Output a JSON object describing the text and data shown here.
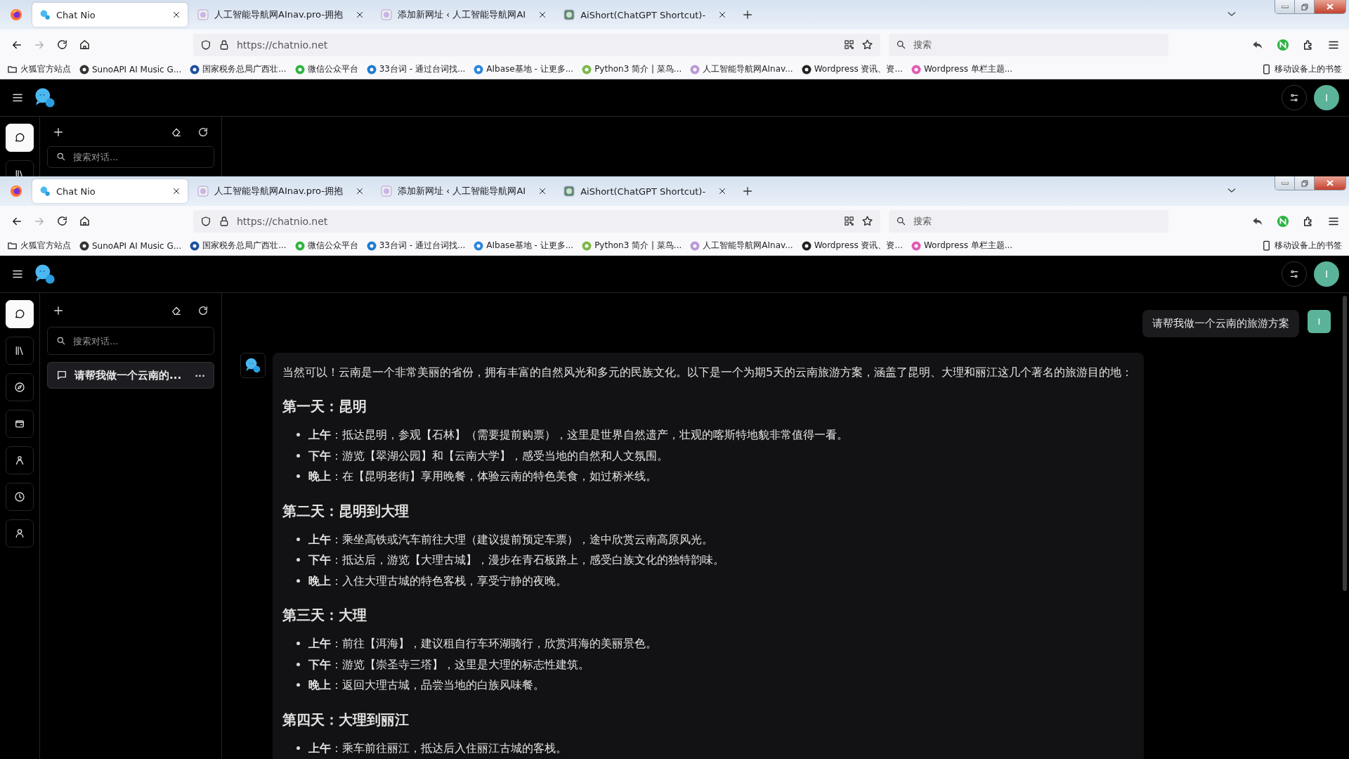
{
  "windows": [
    {
      "tabs": [
        {
          "title": "Chat Nio",
          "selected": true
        },
        {
          "title": "人工智能导航网AInav.pro-拥抱",
          "selected": false
        },
        {
          "title": "添加新网址 ‹ 人工智能导航网AI",
          "selected": false
        },
        {
          "title": "AiShort(ChatGPT Shortcut)-",
          "selected": false
        }
      ],
      "toolbar": {
        "back_disabled": false,
        "forward_disabled": true,
        "url": "https://chatnio.net",
        "search_placeholder": "搜索"
      },
      "bookmarks": [
        "火狐官方站点",
        "SunoAPI AI Music G...",
        "国家税务总局广西壮...",
        "微信公众平台",
        "33台词 - 通过台词找...",
        "AIbase基地 - 让更多...",
        "Python3 简介 | 菜鸟...",
        "人工智能导航网AInav...",
        "Wordpress 资讯、资...",
        "Wordpress 单栏主题..."
      ],
      "mobile_bookmarks": "移动设备上的书签",
      "app": {
        "user_initial": "I",
        "nav": [
          {
            "kind": "chat",
            "selected": true
          },
          {
            "kind": "library",
            "selected": false
          }
        ],
        "search_placeholder": "搜索对话..."
      }
    },
    {
      "tabs": [
        {
          "title": "Chat Nio",
          "selected": true
        },
        {
          "title": "人工智能导航网AInav.pro-拥抱",
          "selected": false
        },
        {
          "title": "添加新网址 ‹ 人工智能导航网AI",
          "selected": false
        },
        {
          "title": "AiShort(ChatGPT Shortcut)-",
          "selected": false
        }
      ],
      "toolbar": {
        "back_disabled": false,
        "forward_disabled": true,
        "url": "https://chatnio.net",
        "search_placeholder": "搜索"
      },
      "bookmarks": [
        "火狐官方站点",
        "SunoAPI AI Music G...",
        "国家税务总局广西壮...",
        "微信公众平台",
        "33台词 - 通过台词找...",
        "AIbase基地 - 让更多...",
        "Python3 简介 | 菜鸟...",
        "人工智能导航网AInav...",
        "Wordpress 资讯、资...",
        "Wordpress 单栏主题..."
      ],
      "mobile_bookmarks": "移动设备上的书签",
      "app": {
        "user_initial": "I",
        "nav": [
          {
            "kind": "chat",
            "selected": true
          },
          {
            "kind": "library",
            "selected": false
          },
          {
            "kind": "compass",
            "selected": false
          },
          {
            "kind": "wallet",
            "selected": false
          },
          {
            "kind": "agent",
            "selected": false
          },
          {
            "kind": "history",
            "selected": false
          },
          {
            "kind": "user",
            "selected": false
          }
        ],
        "search_placeholder": "搜索对话...",
        "conversations": [
          {
            "title": "请帮我做一个云南的...",
            "menu": "···",
            "selected": true
          }
        ],
        "messages": [
          {
            "kind": "user",
            "avatar": "I",
            "text": "请帮我做一个云南的旅游方案"
          },
          {
            "kind": "assistant",
            "intro": "当然可以！云南是一个非常美丽的省份，拥有丰富的自然风光和多元的民族文化。以下是一个为期5天的云南旅游方案，涵盖了昆明、大理和丽江这几个著名的旅游目的地：",
            "sections": [
              {
                "heading": "第一天：昆明",
                "items": [
                  "**上午**：抵达昆明，参观【石林】（需要提前购票），这里是世界自然遗产，壮观的喀斯特地貌非常值得一看。",
                  "**下午**：游览【翠湖公园】和【云南大学】，感受当地的自然和人文氛围。",
                  "**晚上**：在【昆明老街】享用晚餐，体验云南的特色美食，如过桥米线。"
                ]
              },
              {
                "heading": "第二天：昆明到大理",
                "items": [
                  "**上午**：乘坐高铁或汽车前往大理（建议提前预定车票），途中欣赏云南高原风光。",
                  "**下午**：抵达后，游览【大理古城】，漫步在青石板路上，感受白族文化的独特韵味。",
                  "**晚上**：入住大理古城的特色客栈，享受宁静的夜晚。"
                ]
              },
              {
                "heading": "第三天：大理",
                "items": [
                  "**上午**：前往【洱海】，建议租自行车环湖骑行，欣赏洱海的美丽景色。",
                  "**下午**：游览【崇圣寺三塔】，这里是大理的标志性建筑。",
                  "**晚上**：返回大理古城，品尝当地的白族风味餐。"
                ]
              },
              {
                "heading": "第四天：大理到丽江",
                "items": [
                  "**上午**：乘车前往丽江，抵达后入住丽江古城的客栈。"
                ]
              }
            ]
          }
        ]
      }
    }
  ]
}
